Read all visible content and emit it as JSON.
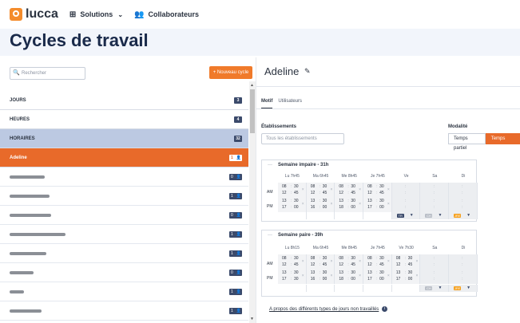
{
  "topbar": {
    "logo_text": "lucca",
    "solutions_label": "Solutions",
    "collaborateurs_label": "Collaborateurs"
  },
  "page": {
    "title": "Cycles de travail"
  },
  "left": {
    "search_placeholder": "Rechercher",
    "new_cycle_label": "+ Nouveau cycle",
    "groups": [
      {
        "label": "JOURS",
        "count": "3"
      },
      {
        "label": "HEURES",
        "count": "4"
      },
      {
        "label": "HORAIRES",
        "count": "32"
      }
    ],
    "selected_item": {
      "label": "Adeline",
      "count": "1"
    },
    "item_counts": [
      "0",
      "1",
      "0",
      "1",
      "1",
      "0",
      "1",
      "1",
      "1"
    ]
  },
  "detail": {
    "title": "Adeline",
    "tabs": [
      "Motif",
      "Utilisateurs"
    ],
    "etablissements_label": "Établissements",
    "etablissements_placeholder": "Tous les établissements",
    "modalite_label": "Modalité",
    "modalite_options": [
      "Temps partiel",
      "Temps plein"
    ],
    "am_label": "AM",
    "pm_label": "PM",
    "week_impaire": {
      "title": "Semaine impaire - 31h",
      "days": [
        "Lu 7h45",
        "Ma 6h45",
        "Me 8h45",
        "Je 7h45",
        "Ve",
        "Sa",
        "Di"
      ],
      "slots": [
        [
          "08",
          "30",
          "12",
          "45",
          "13",
          "30",
          "17",
          "00"
        ],
        [
          "08",
          "30",
          "12",
          "45",
          "13",
          "30",
          "16",
          "00"
        ],
        [
          "08",
          "30",
          "12",
          "45",
          "13",
          "30",
          "18",
          "00"
        ],
        [
          "08",
          "30",
          "12",
          "45",
          "13",
          "30",
          "17",
          "00"
        ]
      ],
      "types": [
        "TR",
        "CH",
        "JRE"
      ]
    },
    "week_paire": {
      "title": "Semaine paire - 39h",
      "days": [
        "Lu 8h15",
        "Ma 6h45",
        "Me 8h45",
        "Je 7h45",
        "Ve 7h30",
        "Sa",
        "Di"
      ],
      "slots": [
        [
          "08",
          "30",
          "12",
          "45",
          "13",
          "30",
          "17",
          "30"
        ],
        [
          "08",
          "30",
          "12",
          "45",
          "13",
          "30",
          "16",
          "00"
        ],
        [
          "08",
          "30",
          "12",
          "45",
          "13",
          "30",
          "18",
          "00"
        ],
        [
          "08",
          "30",
          "12",
          "45",
          "13",
          "30",
          "17",
          "00"
        ],
        [
          "08",
          "30",
          "12",
          "45",
          "13",
          "30",
          "17",
          "00"
        ]
      ],
      "types": [
        "CH",
        "JRE"
      ]
    },
    "footer_link": "A propos des différents types de jours non travaillés"
  },
  "icons": [
    "lucca-logo-icon",
    "grid-icon",
    "people-icon",
    "search-icon",
    "pencil-icon",
    "info-icon",
    "user-icon"
  ]
}
